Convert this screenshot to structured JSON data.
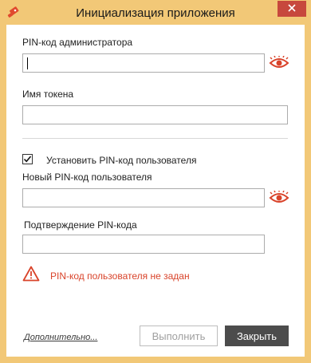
{
  "window": {
    "title": "Инициализация приложения",
    "icon": "token-app-icon",
    "close_icon": "close-icon"
  },
  "form": {
    "admin_pin": {
      "label": "PIN-код администратора",
      "value": ""
    },
    "token_name": {
      "label": "Имя токена",
      "value": ""
    },
    "set_user_pin": {
      "label": "Установить PIN-код пользователя",
      "checked": true
    },
    "new_user_pin": {
      "label": "Новый PIN-код пользователя",
      "value": ""
    },
    "confirm_pin": {
      "label": "Подтверждение PIN-кода",
      "value": ""
    },
    "warning": "PIN-код пользователя не задан"
  },
  "footer": {
    "advanced_link": "Дополнительно...",
    "execute_label": "Выполнить",
    "close_label": "Закрыть"
  },
  "colors": {
    "frame": "#f2c877",
    "accent_red": "#d9432a",
    "close_button": "#c7483d",
    "primary_button": "#4c4c4c"
  }
}
